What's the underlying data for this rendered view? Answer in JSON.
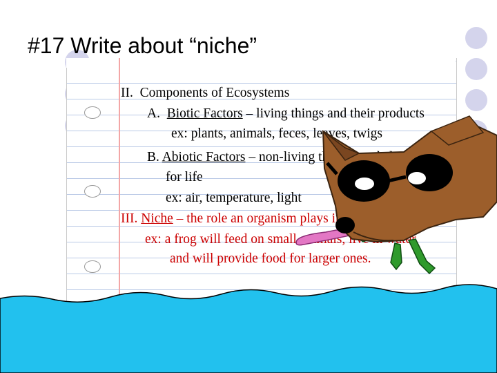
{
  "title": "#17 Write about “niche”",
  "outline": {
    "section2": {
      "numeral": "II.",
      "heading": "Components of Ecosystems",
      "a_letter": "A.",
      "a_term": "Biotic Factors",
      "a_def": "– living things and their products",
      "a_ex": "ex: plants, animals, feces, leaves, twigs",
      "b_letter": "B.",
      "b_term": "Abiotic Factors",
      "b_def": "– non-living things needed",
      "b_def2": "for life",
      "b_ex": "ex: air, temperature, light"
    },
    "section3": {
      "numeral": "III.",
      "term": "Niche",
      "def": "– the role an organism plays in the ecosystem",
      "ex1": "ex: a frog will feed on small animals, live in water,",
      "ex2": "and will provide food for larger ones."
    }
  },
  "colors": {
    "dots": "#d4d4ec",
    "water": "#22c1ee",
    "dog_fur": "#9c5e2b",
    "niche_text": "#cc0000"
  },
  "icons": [
    "binder-hole",
    "dog-drawing",
    "sunglasses",
    "frog-legs",
    "water-wave"
  ]
}
